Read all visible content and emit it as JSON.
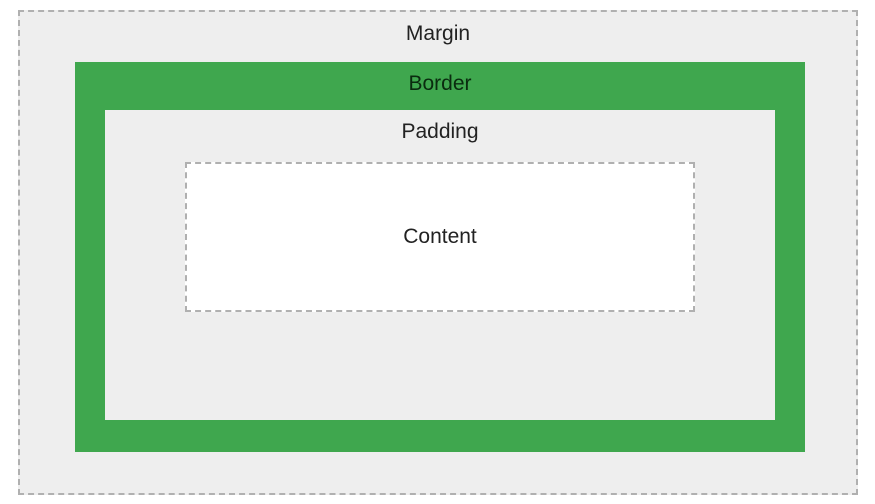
{
  "boxModel": {
    "margin": {
      "label": "Margin"
    },
    "border": {
      "label": "Border"
    },
    "padding": {
      "label": "Padding"
    },
    "content": {
      "label": "Content"
    }
  }
}
